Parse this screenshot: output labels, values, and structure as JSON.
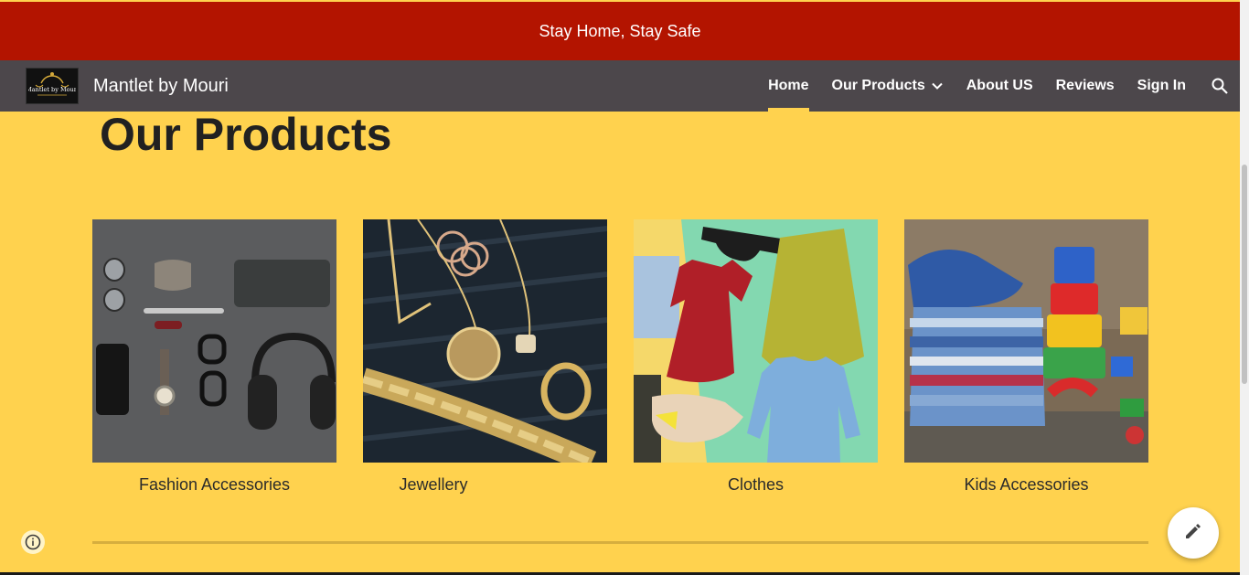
{
  "banner": {
    "text": "Stay Home, Stay Safe"
  },
  "header": {
    "site_title": "Mantlet by Mouri",
    "logo_text": "Mantlet by Mouri",
    "nav": [
      {
        "label": "Home",
        "active": true
      },
      {
        "label": "Our Products",
        "has_dropdown": true
      },
      {
        "label": "About US"
      },
      {
        "label": "Reviews"
      },
      {
        "label": "Sign In"
      }
    ],
    "search_icon": "search-icon"
  },
  "main": {
    "heading": "Our Products",
    "products": [
      {
        "caption": "Fashion Accessories",
        "image": "flat-lay of sunglasses, bow tie, wallet, phone, watch, glasses and headphones"
      },
      {
        "caption": "Jewellery",
        "image": "gold necklaces, rings and chain bracelet on dark wood"
      },
      {
        "caption": "Clothes",
        "image": "collage of red dress, sunglasses, yellow skirt, blue sweater and sneakers"
      },
      {
        "caption": "Kids Accessories",
        "image": "stack of kids clothes with baby shoes and toy blocks"
      }
    ]
  },
  "floating": {
    "info_icon": "info-icon",
    "edit_icon": "edit-pencil-icon"
  },
  "colors": {
    "banner": "#b31400",
    "header": "#4c474b",
    "page_background": "#ffd24e",
    "accent": "#ffd24e"
  }
}
